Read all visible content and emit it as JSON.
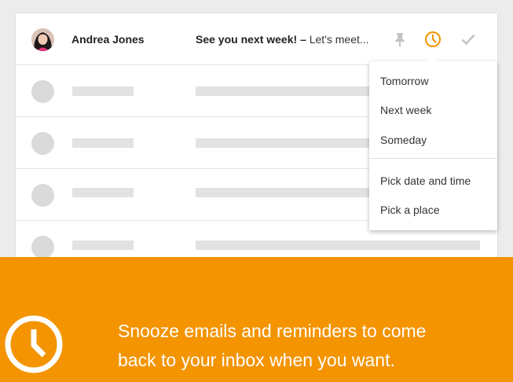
{
  "colors": {
    "accent": "#f39400",
    "placeholder": "#e2e2e2",
    "icon_muted": "#c4c4c4"
  },
  "inbox": {
    "active_row": {
      "sender": "Andrea Jones",
      "subject": "See you next week! –",
      "preview": "Let's meet...",
      "icons": [
        "pin-icon",
        "clock-icon",
        "checkmark-icon"
      ]
    },
    "placeholder_rows": 4
  },
  "snooze_menu": {
    "items": [
      "Tomorrow",
      "Next week",
      "Someday"
    ],
    "extra_items": [
      "Pick date and time",
      "Pick a place"
    ]
  },
  "banner": {
    "icon": "clock-icon",
    "line1": "Snooze emails and reminders to come",
    "line2": "back to your inbox when you want."
  }
}
